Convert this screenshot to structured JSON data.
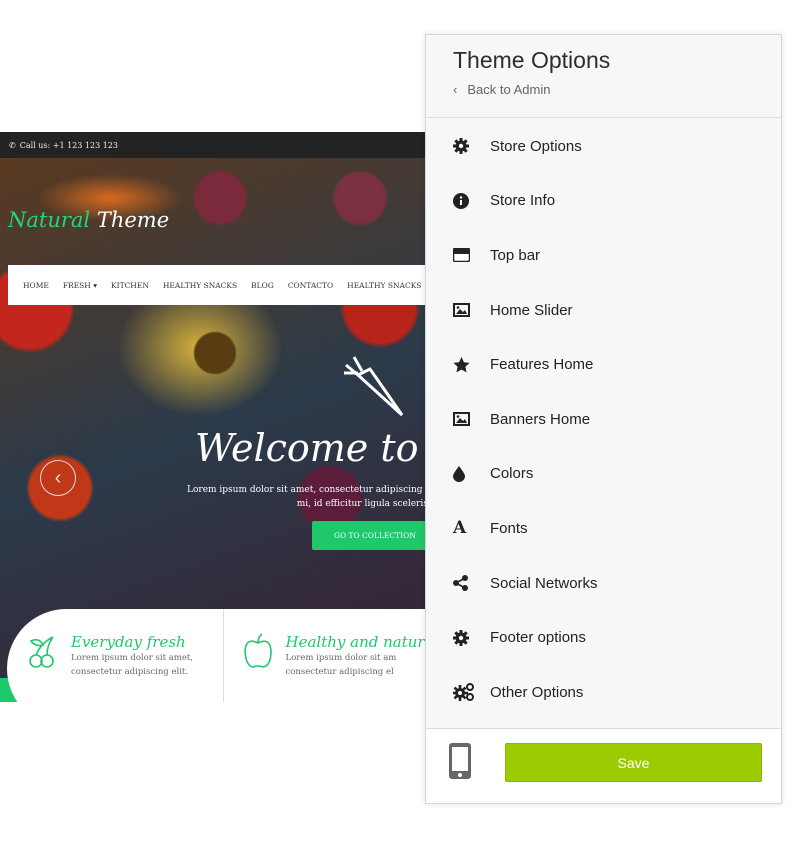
{
  "site": {
    "topbar": {
      "phone_icon": "phone-icon",
      "call": "Call us: +1 123 123 123"
    },
    "logo": {
      "part1": "Natural",
      "part2": "Theme"
    },
    "nav": [
      "HOME",
      "FRESH ▾",
      "KITCHEN",
      "HEALTHY SNACKS",
      "BLOG",
      "CONTACTO",
      "HEALTHY SNACKS"
    ],
    "hero": {
      "title": "Welcome to Natur",
      "line1": "Lorem ipsum dolor sit amet, consectetur adipiscing el",
      "line2": "mi, id efficitur ligula scelerisq",
      "cta": "GO TO COLLECTION",
      "prev": "‹"
    },
    "features": [
      {
        "icon": "cherry-icon",
        "title": "Everyday fresh",
        "line1": "Lorem ipsum dolor sit amet,",
        "line2": "consectetur adipiscing elit."
      },
      {
        "icon": "apple-icon",
        "title": "Healthy and natur",
        "line1": "Lorem ipsum dolor sit am",
        "line2": "consectetur adipiscing el"
      }
    ],
    "accent": "#1ec96b"
  },
  "panel": {
    "title": "Theme Options",
    "back": "Back to Admin",
    "items": [
      {
        "label": "Store Options",
        "icon": "gear-icon"
      },
      {
        "label": "Store Info",
        "icon": "info-icon"
      },
      {
        "label": "Top bar",
        "icon": "top-bar-icon"
      },
      {
        "label": "Home Slider",
        "icon": "image-icon"
      },
      {
        "label": "Features Home",
        "icon": "star-icon"
      },
      {
        "label": "Banners Home",
        "icon": "image-icon"
      },
      {
        "label": "Colors",
        "icon": "drop-icon"
      },
      {
        "label": "Fonts",
        "icon": "font-icon"
      },
      {
        "label": "Social Networks",
        "icon": "share-icon"
      },
      {
        "label": "Footer options",
        "icon": "gear-icon"
      },
      {
        "label": "Other Options",
        "icon": "gears-icon"
      }
    ],
    "save": "Save",
    "save_color": "#9bcb00"
  }
}
